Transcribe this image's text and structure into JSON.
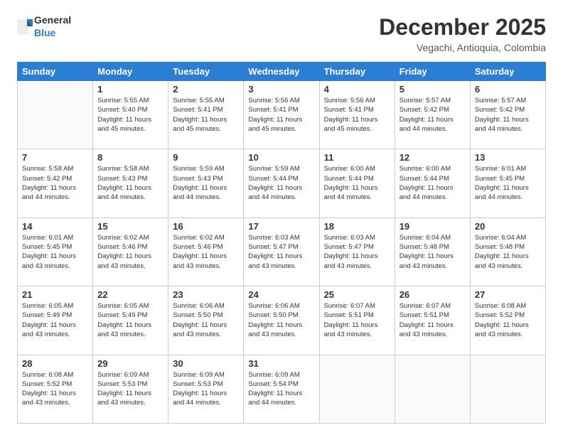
{
  "header": {
    "logo": {
      "general": "General",
      "blue": "Blue"
    },
    "title": "December 2025",
    "location": "Vegachi, Antioquia, Colombia"
  },
  "days_of_week": [
    "Sunday",
    "Monday",
    "Tuesday",
    "Wednesday",
    "Thursday",
    "Friday",
    "Saturday"
  ],
  "weeks": [
    [
      {
        "day": "",
        "info": ""
      },
      {
        "day": "1",
        "info": "Sunrise: 5:55 AM\nSunset: 5:40 PM\nDaylight: 11 hours\nand 45 minutes."
      },
      {
        "day": "2",
        "info": "Sunrise: 5:55 AM\nSunset: 5:41 PM\nDaylight: 11 hours\nand 45 minutes."
      },
      {
        "day": "3",
        "info": "Sunrise: 5:56 AM\nSunset: 5:41 PM\nDaylight: 11 hours\nand 45 minutes."
      },
      {
        "day": "4",
        "info": "Sunrise: 5:56 AM\nSunset: 5:41 PM\nDaylight: 11 hours\nand 45 minutes."
      },
      {
        "day": "5",
        "info": "Sunrise: 5:57 AM\nSunset: 5:42 PM\nDaylight: 11 hours\nand 44 minutes."
      },
      {
        "day": "6",
        "info": "Sunrise: 5:57 AM\nSunset: 5:42 PM\nDaylight: 11 hours\nand 44 minutes."
      }
    ],
    [
      {
        "day": "7",
        "info": "Sunrise: 5:58 AM\nSunset: 5:42 PM\nDaylight: 11 hours\nand 44 minutes."
      },
      {
        "day": "8",
        "info": "Sunrise: 5:58 AM\nSunset: 5:43 PM\nDaylight: 11 hours\nand 44 minutes."
      },
      {
        "day": "9",
        "info": "Sunrise: 5:59 AM\nSunset: 5:43 PM\nDaylight: 11 hours\nand 44 minutes."
      },
      {
        "day": "10",
        "info": "Sunrise: 5:59 AM\nSunset: 5:44 PM\nDaylight: 11 hours\nand 44 minutes."
      },
      {
        "day": "11",
        "info": "Sunrise: 6:00 AM\nSunset: 5:44 PM\nDaylight: 11 hours\nand 44 minutes."
      },
      {
        "day": "12",
        "info": "Sunrise: 6:00 AM\nSunset: 5:44 PM\nDaylight: 11 hours\nand 44 minutes."
      },
      {
        "day": "13",
        "info": "Sunrise: 6:01 AM\nSunset: 5:45 PM\nDaylight: 11 hours\nand 44 minutes."
      }
    ],
    [
      {
        "day": "14",
        "info": "Sunrise: 6:01 AM\nSunset: 5:45 PM\nDaylight: 11 hours\nand 43 minutes."
      },
      {
        "day": "15",
        "info": "Sunrise: 6:02 AM\nSunset: 5:46 PM\nDaylight: 11 hours\nand 43 minutes."
      },
      {
        "day": "16",
        "info": "Sunrise: 6:02 AM\nSunset: 5:46 PM\nDaylight: 11 hours\nand 43 minutes."
      },
      {
        "day": "17",
        "info": "Sunrise: 6:03 AM\nSunset: 5:47 PM\nDaylight: 11 hours\nand 43 minutes."
      },
      {
        "day": "18",
        "info": "Sunrise: 6:03 AM\nSunset: 5:47 PM\nDaylight: 11 hours\nand 43 minutes."
      },
      {
        "day": "19",
        "info": "Sunrise: 6:04 AM\nSunset: 5:48 PM\nDaylight: 11 hours\nand 43 minutes."
      },
      {
        "day": "20",
        "info": "Sunrise: 6:04 AM\nSunset: 5:48 PM\nDaylight: 11 hours\nand 43 minutes."
      }
    ],
    [
      {
        "day": "21",
        "info": "Sunrise: 6:05 AM\nSunset: 5:49 PM\nDaylight: 11 hours\nand 43 minutes."
      },
      {
        "day": "22",
        "info": "Sunrise: 6:05 AM\nSunset: 5:49 PM\nDaylight: 11 hours\nand 43 minutes."
      },
      {
        "day": "23",
        "info": "Sunrise: 6:06 AM\nSunset: 5:50 PM\nDaylight: 11 hours\nand 43 minutes."
      },
      {
        "day": "24",
        "info": "Sunrise: 6:06 AM\nSunset: 5:50 PM\nDaylight: 11 hours\nand 43 minutes."
      },
      {
        "day": "25",
        "info": "Sunrise: 6:07 AM\nSunset: 5:51 PM\nDaylight: 11 hours\nand 43 minutes."
      },
      {
        "day": "26",
        "info": "Sunrise: 6:07 AM\nSunset: 5:51 PM\nDaylight: 11 hours\nand 43 minutes."
      },
      {
        "day": "27",
        "info": "Sunrise: 6:08 AM\nSunset: 5:52 PM\nDaylight: 11 hours\nand 43 minutes."
      }
    ],
    [
      {
        "day": "28",
        "info": "Sunrise: 6:08 AM\nSunset: 5:52 PM\nDaylight: 11 hours\nand 43 minutes."
      },
      {
        "day": "29",
        "info": "Sunrise: 6:09 AM\nSunset: 5:53 PM\nDaylight: 11 hours\nand 43 minutes."
      },
      {
        "day": "30",
        "info": "Sunrise: 6:09 AM\nSunset: 5:53 PM\nDaylight: 11 hours\nand 44 minutes."
      },
      {
        "day": "31",
        "info": "Sunrise: 6:09 AM\nSunset: 5:54 PM\nDaylight: 11 hours\nand 44 minutes."
      },
      {
        "day": "",
        "info": ""
      },
      {
        "day": "",
        "info": ""
      },
      {
        "day": "",
        "info": ""
      }
    ]
  ]
}
